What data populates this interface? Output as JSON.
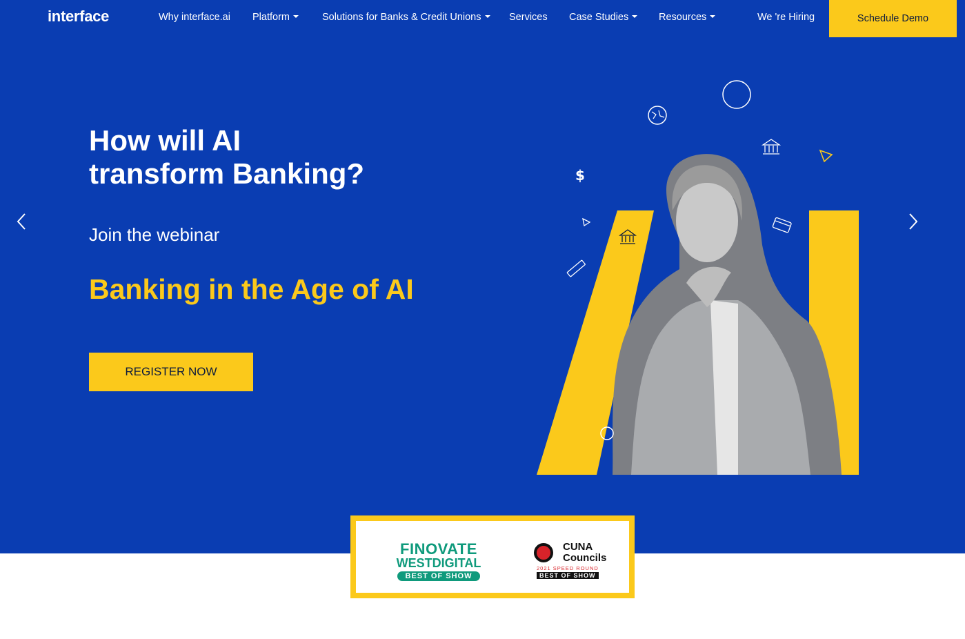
{
  "nav": {
    "logo": "interface",
    "items": [
      {
        "label": "Why interface.ai",
        "dropdown": false
      },
      {
        "label": "Platform",
        "dropdown": true
      },
      {
        "label": "Solutions for Banks & Credit Unions",
        "dropdown": true
      },
      {
        "label": "Services",
        "dropdown": false
      },
      {
        "label": "Case Studies",
        "dropdown": true
      },
      {
        "label": "Resources",
        "dropdown": true
      },
      {
        "label": "We 're Hiring",
        "dropdown": false
      }
    ],
    "cta": "Schedule Demo"
  },
  "hero": {
    "title_line1": "How will AI",
    "title_line2": "transform Banking?",
    "subtitle": "Join the webinar",
    "highlight": "Banking in the Age of AI",
    "register_label": "REGISTER NOW"
  },
  "awards": {
    "finovate": {
      "line1": "FINOVATE",
      "line2": "WESTDIGITAL",
      "badge": "BEST OF SHOW"
    },
    "cuna": {
      "line1": "CUNA",
      "line2": "Councils",
      "line3": "2021 SPEED ROUND",
      "badge": "BEST OF SHOW"
    }
  },
  "colors": {
    "primary_blue": "#0a3db2",
    "accent_yellow": "#fbc91b",
    "finovate_green": "#0f9a7c",
    "cuna_red": "#d8232a"
  }
}
